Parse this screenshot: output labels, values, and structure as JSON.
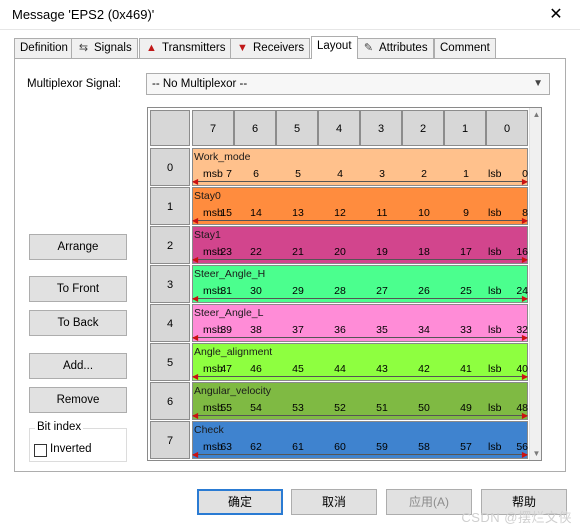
{
  "window": {
    "title": "Message 'EPS2 (0x469)'"
  },
  "tabs": [
    {
      "label": "Definition",
      "icon": ""
    },
    {
      "label": "Signals",
      "icon": "signals-icon"
    },
    {
      "label": "Transmitters",
      "icon": "transmitter-icon"
    },
    {
      "label": "Receivers",
      "icon": "receiver-icon"
    },
    {
      "label": "Layout",
      "icon": ""
    },
    {
      "label": "Attributes",
      "icon": "attributes-icon"
    },
    {
      "label": "Comment",
      "icon": ""
    }
  ],
  "active_tab": "Layout",
  "multiplexor": {
    "label": "Multiplexor Signal:",
    "value": "-- No Multiplexor --"
  },
  "side_buttons": {
    "arrange": "Arrange",
    "to_front": "To Front",
    "to_back": "To Back",
    "add": "Add...",
    "remove": "Remove"
  },
  "bit_index": {
    "label": "Bit index",
    "inverted_label": "Inverted",
    "inverted_checked": false
  },
  "layout": {
    "col_headers": [
      "7",
      "6",
      "5",
      "4",
      "3",
      "2",
      "1",
      "0"
    ],
    "msb_label": "msb",
    "lsb_label": "lsb",
    "rows": [
      {
        "index": "0",
        "signal": "Work_mode",
        "color": "#FFC18C",
        "bits": [
          "7",
          "6",
          "5",
          "4",
          "3",
          "2",
          "1",
          "0"
        ]
      },
      {
        "index": "1",
        "signal": "Stay0",
        "color": "#FF8C3E",
        "bits": [
          "15",
          "14",
          "13",
          "12",
          "11",
          "10",
          "9",
          "8"
        ]
      },
      {
        "index": "2",
        "signal": "Stay1",
        "color": "#D2458D",
        "bits": [
          "23",
          "22",
          "21",
          "20",
          "19",
          "18",
          "17",
          "16"
        ]
      },
      {
        "index": "3",
        "signal": "Steer_Angle_H",
        "color": "#4BFF8E",
        "bits": [
          "31",
          "30",
          "29",
          "28",
          "27",
          "26",
          "25",
          "24"
        ]
      },
      {
        "index": "4",
        "signal": "Steer_Angle_L",
        "color": "#FF8CD7",
        "bits": [
          "39",
          "38",
          "37",
          "36",
          "35",
          "34",
          "33",
          "32"
        ]
      },
      {
        "index": "5",
        "signal": "Angle_alignment",
        "color": "#8EFF40",
        "bits": [
          "47",
          "46",
          "45",
          "44",
          "43",
          "42",
          "41",
          "40"
        ]
      },
      {
        "index": "6",
        "signal": "Angular_velocity",
        "color": "#7FBA43",
        "bits": [
          "55",
          "54",
          "53",
          "52",
          "51",
          "50",
          "49",
          "48"
        ]
      },
      {
        "index": "7",
        "signal": "Check",
        "color": "#3F83CF",
        "bits": [
          "63",
          "62",
          "61",
          "60",
          "59",
          "58",
          "57",
          "56"
        ]
      }
    ]
  },
  "footer_buttons": {
    "ok": "确定",
    "cancel": "取消",
    "apply": "应用(A)",
    "help": "帮助"
  },
  "watermark": "CSDN @摆烂文侠"
}
